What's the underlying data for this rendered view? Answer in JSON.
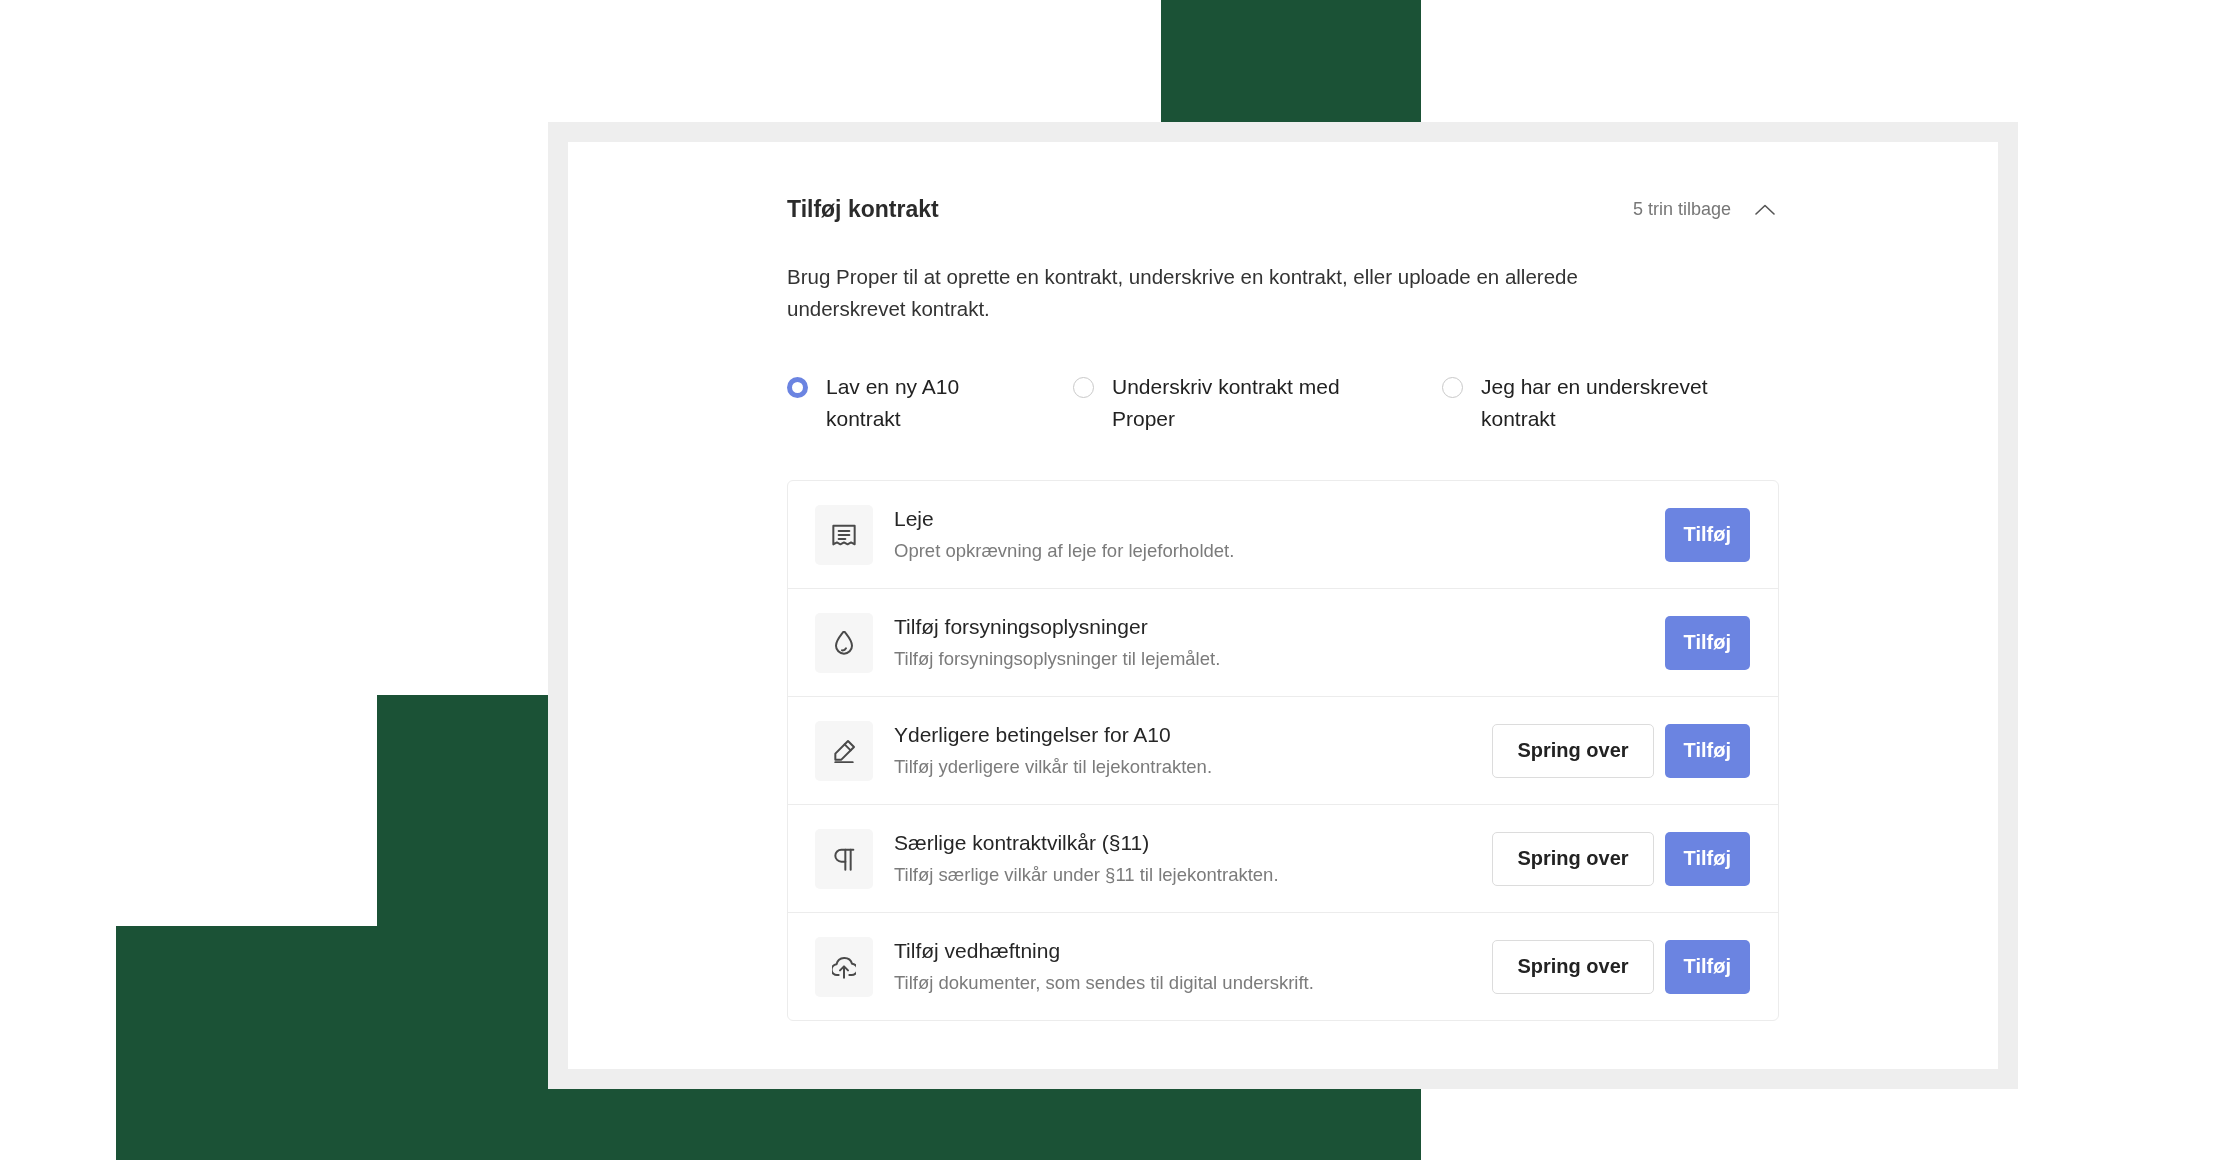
{
  "header": {
    "title": "Tilføj kontrakt",
    "steps_back": "5 trin tilbage",
    "expanded": true
  },
  "description": "Brug Proper til at oprette en kontrakt, underskrive en kontrakt, eller uploade en allerede underskrevet kontrakt.",
  "options": [
    {
      "label": "Lav en ny A10 kontrakt",
      "selected": true
    },
    {
      "label": "Underskriv kontrakt med Proper",
      "selected": false
    },
    {
      "label": "Jeg har en underskrevet kontrakt",
      "selected": false
    }
  ],
  "tasks": [
    {
      "title": "Leje",
      "description": "Opret opkrævning af leje for lejeforholdet.",
      "buttons": [
        {
          "label": "Tilføj",
          "kind": "primary"
        }
      ]
    },
    {
      "title": "Tilføj forsyningsoplysninger",
      "description": "Tilføj forsyningsoplysninger til lejemålet.",
      "buttons": [
        {
          "label": "Tilføj",
          "kind": "primary"
        }
      ]
    },
    {
      "title": "Yderligere betingelser for A10",
      "description": "Tilføj yderligere vilkår til lejekontrakten.",
      "buttons": [
        {
          "label": "Spring over",
          "kind": "secondary"
        },
        {
          "label": "Tilføj",
          "kind": "primary"
        }
      ]
    },
    {
      "title": "Særlige kontraktvilkår (§11)",
      "description": "Tilføj særlige vilkår under §11 til lejekontrakten.",
      "buttons": [
        {
          "label": "Spring over",
          "kind": "secondary"
        },
        {
          "label": "Tilføj",
          "kind": "primary"
        }
      ]
    },
    {
      "title": "Tilføj vedhæftning",
      "description": "Tilføj dokumenter, som sendes til digital underskrift.",
      "buttons": [
        {
          "label": "Spring over",
          "kind": "secondary"
        },
        {
          "label": "Tilføj",
          "kind": "primary"
        }
      ]
    }
  ]
}
